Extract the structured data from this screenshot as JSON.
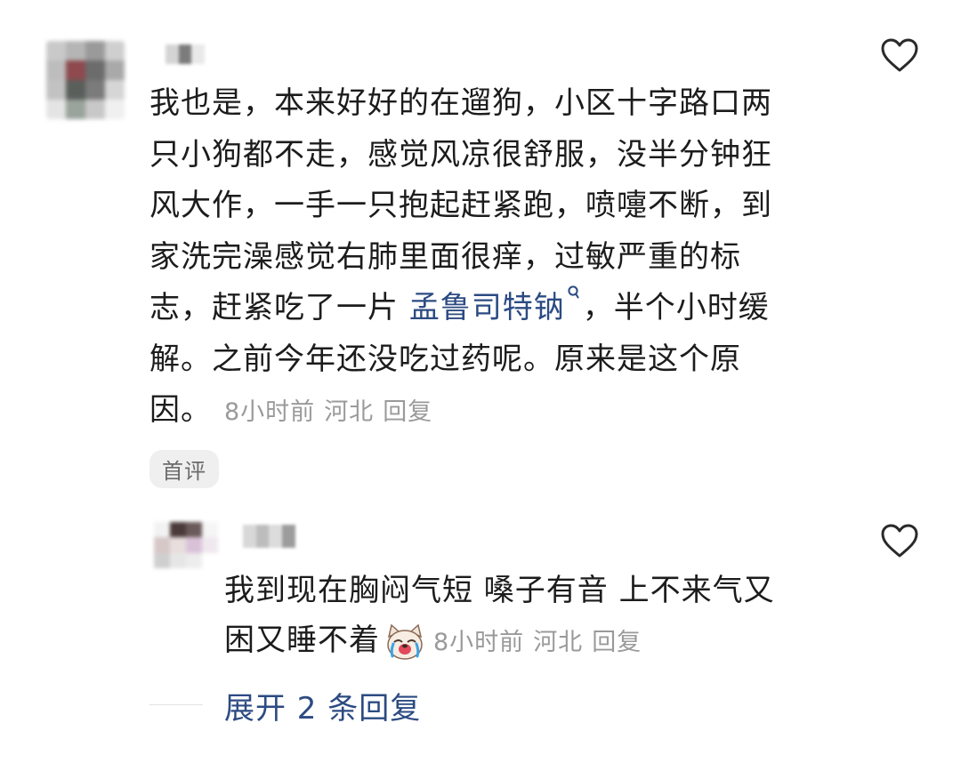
{
  "main_comment": {
    "username": "",
    "lines": [
      "我也是，本来好好的在遛狗，小区十字路口两",
      "只小狗都不走，感觉风凉很舒服，没半分钟狂",
      "风大作，一手一只抱起赶紧跑，喷嚏不断，到",
      "家洗完澡感觉右肺里面很痒，过敏严重的标"
    ],
    "line5_before": "志，赶紧吃了一片 ",
    "search_link": "孟鲁司特钠",
    "line5_after": "，半个小时缓",
    "line6": "解。之前今年还没吃过药呢。原来是这个原",
    "line7": "因。",
    "time": "8小时前",
    "location": "河北",
    "reply_label": "回复",
    "badge": "首评",
    "search_icon": "search-icon",
    "like_icon": "heart-outline-icon"
  },
  "reply_comment": {
    "username": "",
    "line1": "我到现在胸闷气短  嗓子有音  上不来气又",
    "line2": "困又睡不着",
    "emoji": "crying-dog-emoji",
    "time": "8小时前",
    "location": "河北",
    "reply_label": "回复",
    "like_icon": "heart-outline-icon"
  },
  "expand_replies": "展开 2 条回复",
  "colors": {
    "text": "#1c1c1c",
    "meta": "#9a9a9a",
    "link": "#2c4b82",
    "badge_bg": "#efefef"
  }
}
